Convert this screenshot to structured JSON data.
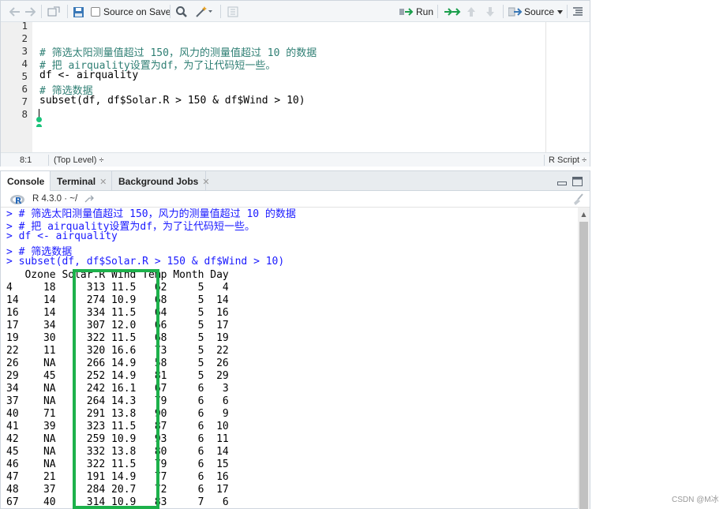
{
  "editor": {
    "toolbar": {
      "source_on_save_label": "Source on Save",
      "run_label": "Run",
      "source_label": "Source"
    },
    "lines": [
      {
        "num": "1",
        "text": ""
      },
      {
        "num": "2",
        "text": ""
      },
      {
        "num": "3",
        "text": "# 筛选太阳测量值超过 150，风力的测量值超过 10 的数据",
        "kind": "comment"
      },
      {
        "num": "4",
        "text": "# 把 airquality设置为df，为了让代码短一些。",
        "kind": "comment"
      },
      {
        "num": "5",
        "text": "df <- airquality",
        "kind": "code"
      },
      {
        "num": "6",
        "text": "# 筛选数据",
        "kind": "comment"
      },
      {
        "num": "7",
        "text": "subset(df, df$Solar.R > 150 & df$Wind > 10)",
        "kind": "code"
      },
      {
        "num": "8",
        "text": ""
      }
    ],
    "status": {
      "position": "8:1",
      "scope": "(Top Level) ÷",
      "filetype": "R Script ÷"
    }
  },
  "console": {
    "tabs": [
      {
        "label": "Console",
        "active": true
      },
      {
        "label": "Terminal",
        "active": false,
        "closable": true
      },
      {
        "label": "Background Jobs",
        "active": false,
        "closable": true
      }
    ],
    "r_version": "R 4.3.0 · ~/",
    "input_lines": [
      "> # 筛选太阳测量值超过 150，风力的测量值超过 10 的数据",
      "> # 把 airquality设置为df，为了让代码短一些。",
      "> df <- airquality",
      "> # 筛选数据",
      "> subset(df, df$Solar.R > 150 & df$Wind > 10)"
    ],
    "table_header": "   Ozone Solar.R Wind Temp Month Day",
    "table_rows": [
      "4     18     313 11.5   62     5   4",
      "14    14     274 10.9   68     5  14",
      "16    14     334 11.5   64     5  16",
      "17    34     307 12.0   66     5  17",
      "19    30     322 11.5   68     5  19",
      "22    11     320 16.6   73     5  22",
      "26    NA     266 14.9   58     5  26",
      "29    45     252 14.9   81     5  29",
      "34    NA     242 16.1   67     6   3",
      "37    NA     264 14.3   79     6   6",
      "40    71     291 13.8   90     6   9",
      "41    39     323 11.5   87     6  10",
      "42    NA     259 10.9   93     6  11",
      "45    NA     332 13.8   80     6  14",
      "46    NA     322 11.5   79     6  15",
      "47    21     191 14.9   77     6  16",
      "48    37     284 20.7   72     6  17",
      "67    40     314 10.9   83     7   6"
    ]
  },
  "watermark": "CSDN @M冰",
  "colors": {
    "highlight_border": "#1db14b",
    "console_input": "#1a1aff",
    "editor_comment": "#2f7f74"
  }
}
